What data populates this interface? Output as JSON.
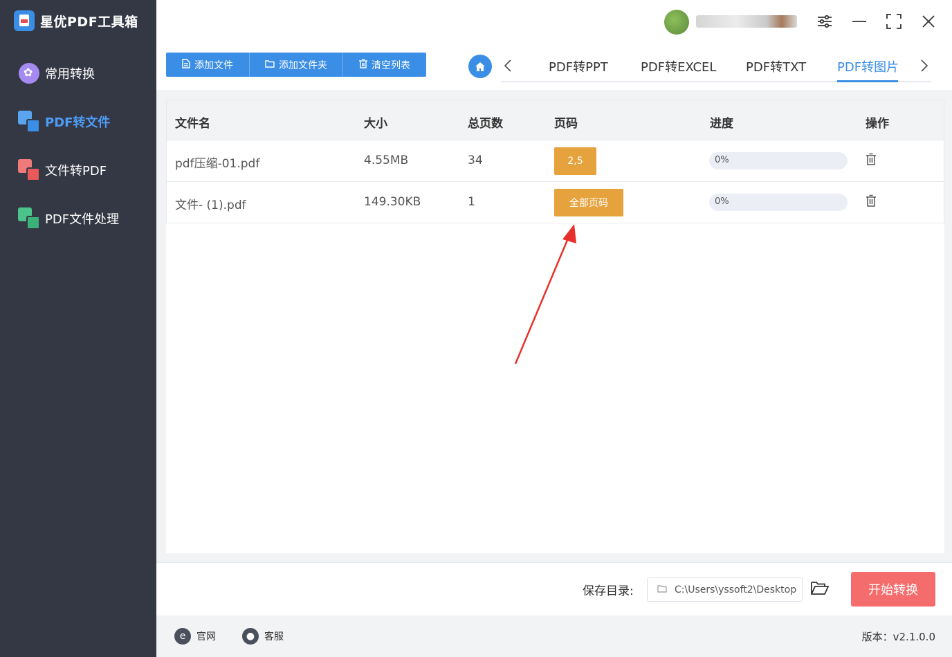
{
  "app": {
    "title": "星优PDF工具箱",
    "icons": {
      "logo": "pdf-doc-icon"
    }
  },
  "sidebar": {
    "items": [
      {
        "label": "常用转换",
        "icon": "flower-icon",
        "active": false
      },
      {
        "label": "PDF转文件",
        "icon": "pdf-to-file-icon",
        "active": true
      },
      {
        "label": "文件转PDF",
        "icon": "file-to-pdf-icon",
        "active": false
      },
      {
        "label": "PDF文件处理",
        "icon": "pdf-process-icon",
        "active": false
      }
    ]
  },
  "toolbar": {
    "add_file": "添加文件",
    "add_folder": "添加文件夹",
    "clear_list": "清空列表"
  },
  "tabs": {
    "items": [
      "PDF转PPT",
      "PDF转EXCEL",
      "PDF转TXT",
      "PDF转图片"
    ],
    "active": "PDF转图片"
  },
  "table": {
    "headers": [
      "文件名",
      "大小",
      "总页数",
      "页码",
      "进度",
      "操作"
    ],
    "rows": [
      {
        "name": "pdf压缩-01.pdf",
        "size": "4.55MB",
        "pages": "34",
        "page_range": "2,5",
        "progress": "0%"
      },
      {
        "name": "文件- (1).pdf",
        "size": "149.30KB",
        "pages": "1",
        "page_range": "全部页码",
        "progress": "0%"
      }
    ]
  },
  "bottom": {
    "save_label": "保存目录:",
    "save_path": "C:\\Users\\yssoft2\\Desktop",
    "start_button": "开始转换"
  },
  "footer": {
    "website": "官网",
    "support": "客服",
    "version": "版本：v2.1.0.0"
  },
  "colors": {
    "sidebar_bg": "#343845",
    "accent": "#3a8ee6",
    "page_button": "#e6a23c",
    "start_button": "#f56c6c",
    "annotation_arrow": "#e8302a"
  }
}
